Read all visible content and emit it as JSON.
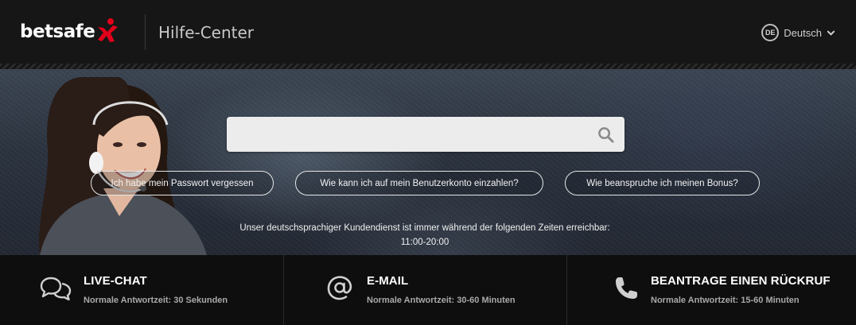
{
  "header": {
    "logo_text": "betsafe",
    "title": "Hilfe-Center",
    "language_code": "DE",
    "language_label": "Deutsch"
  },
  "search": {
    "placeholder": ""
  },
  "quick_links": [
    {
      "label": "Ich habe mein Passwort vergessen"
    },
    {
      "label": "Wie kann ich auf mein Benutzerkonto einzahlen?"
    },
    {
      "label": "Wie beanspruche ich meinen Bonus?"
    }
  ],
  "service": {
    "text": "Unser deutschsprachiger Kundendienst ist immer während der folgenden Zeiten erreichbar:",
    "hours": "11:00-20:00"
  },
  "contact": [
    {
      "icon": "chat-bubbles-icon",
      "title": "LIVE-CHAT",
      "subtitle": "Normale Antwortzeit: 30 Sekunden"
    },
    {
      "icon": "at-sign-icon",
      "title": "E-MAIL",
      "subtitle": "Normale Antwortzeit: 30-60 Minuten"
    },
    {
      "icon": "phone-icon",
      "title": "BEANTRAGE EINEN RÜCKRUF",
      "subtitle": "Normale Antwortzeit: 15-60 Minuten"
    }
  ],
  "colors": {
    "header_bg": "#161616",
    "brand_red": "#e3001b",
    "hero_bg": "#2e3641",
    "contact_bar_bg": "#0e0e0e"
  }
}
